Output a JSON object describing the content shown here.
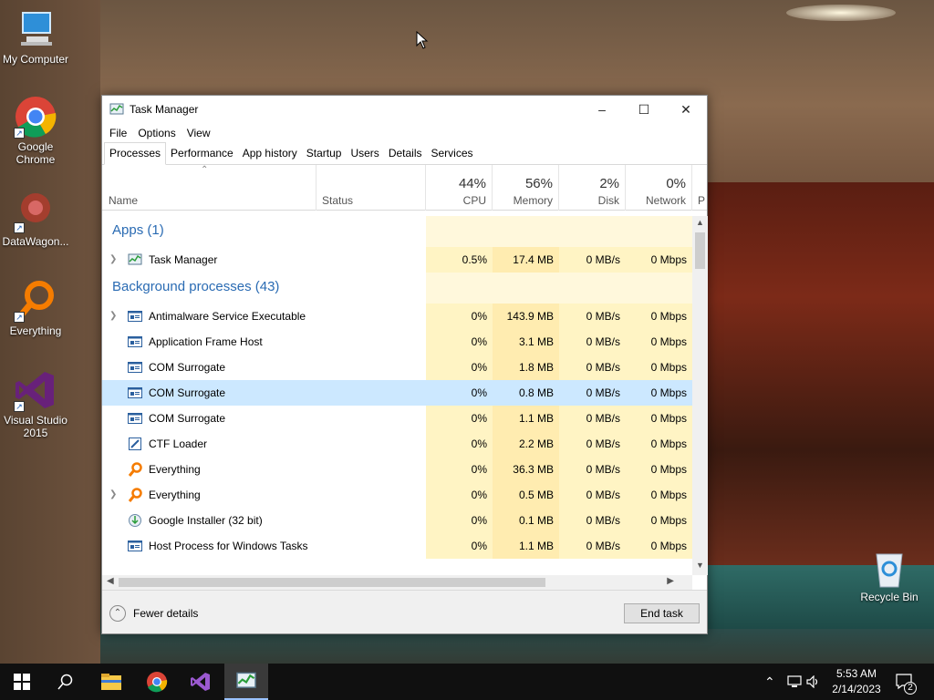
{
  "desktop": {
    "icons": [
      {
        "label": "My Computer"
      },
      {
        "label": "Google Chrome"
      },
      {
        "label": "DataWagon..."
      },
      {
        "label": "Everything"
      },
      {
        "label": "Visual Studio 2015"
      },
      {
        "label": "Recycle Bin"
      }
    ]
  },
  "window": {
    "title": "Task Manager",
    "menu": [
      "File",
      "Options",
      "View"
    ],
    "tabs": [
      "Processes",
      "Performance",
      "App history",
      "Startup",
      "Users",
      "Details",
      "Services"
    ],
    "active_tab": "Processes"
  },
  "columns": {
    "name": "Name",
    "status": "Status",
    "cpu": {
      "label": "CPU",
      "pct": "44%"
    },
    "memory": {
      "label": "Memory",
      "pct": "56%"
    },
    "disk": {
      "label": "Disk",
      "pct": "2%"
    },
    "network": {
      "label": "Network",
      "pct": "0%"
    },
    "power_partial": "P"
  },
  "groups": {
    "apps": "Apps (1)",
    "background": "Background processes (43)"
  },
  "rows": [
    {
      "name": "Task Manager",
      "cpu": "0.5%",
      "mem": "17.4 MB",
      "disk": "0 MB/s",
      "net": "0 Mbps",
      "icon": "task-manager-icon",
      "expandable": true
    },
    {
      "name": "Antimalware Service Executable",
      "cpu": "0%",
      "mem": "143.9 MB",
      "disk": "0 MB/s",
      "net": "0 Mbps",
      "icon": "service-icon",
      "expandable": true
    },
    {
      "name": "Application Frame Host",
      "cpu": "0%",
      "mem": "3.1 MB",
      "disk": "0 MB/s",
      "net": "0 Mbps",
      "icon": "service-icon",
      "expandable": false
    },
    {
      "name": "COM Surrogate",
      "cpu": "0%",
      "mem": "1.8 MB",
      "disk": "0 MB/s",
      "net": "0 Mbps",
      "icon": "service-icon",
      "expandable": false
    },
    {
      "name": "COM Surrogate",
      "cpu": "0%",
      "mem": "0.8 MB",
      "disk": "0 MB/s",
      "net": "0 Mbps",
      "icon": "service-icon",
      "expandable": false,
      "selected": true
    },
    {
      "name": "COM Surrogate",
      "cpu": "0%",
      "mem": "1.1 MB",
      "disk": "0 MB/s",
      "net": "0 Mbps",
      "icon": "service-icon",
      "expandable": false
    },
    {
      "name": "CTF Loader",
      "cpu": "0%",
      "mem": "2.2 MB",
      "disk": "0 MB/s",
      "net": "0 Mbps",
      "icon": "ctf-icon",
      "expandable": false
    },
    {
      "name": "Everything",
      "cpu": "0%",
      "mem": "36.3 MB",
      "disk": "0 MB/s",
      "net": "0 Mbps",
      "icon": "everything-icon",
      "expandable": false
    },
    {
      "name": "Everything",
      "cpu": "0%",
      "mem": "0.5 MB",
      "disk": "0 MB/s",
      "net": "0 Mbps",
      "icon": "everything-icon",
      "expandable": true
    },
    {
      "name": "Google Installer (32 bit)",
      "cpu": "0%",
      "mem": "0.1 MB",
      "disk": "0 MB/s",
      "net": "0 Mbps",
      "icon": "installer-icon",
      "expandable": false
    },
    {
      "name": "Host Process for Windows Tasks",
      "cpu": "0%",
      "mem": "1.1 MB",
      "disk": "0 MB/s",
      "net": "0 Mbps",
      "icon": "service-icon",
      "expandable": false
    }
  ],
  "footer": {
    "fewer_details": "Fewer details",
    "end_task": "End task"
  },
  "taskbar": {
    "time": "5:53 AM",
    "date": "2/14/2023",
    "notifications": "2"
  }
}
